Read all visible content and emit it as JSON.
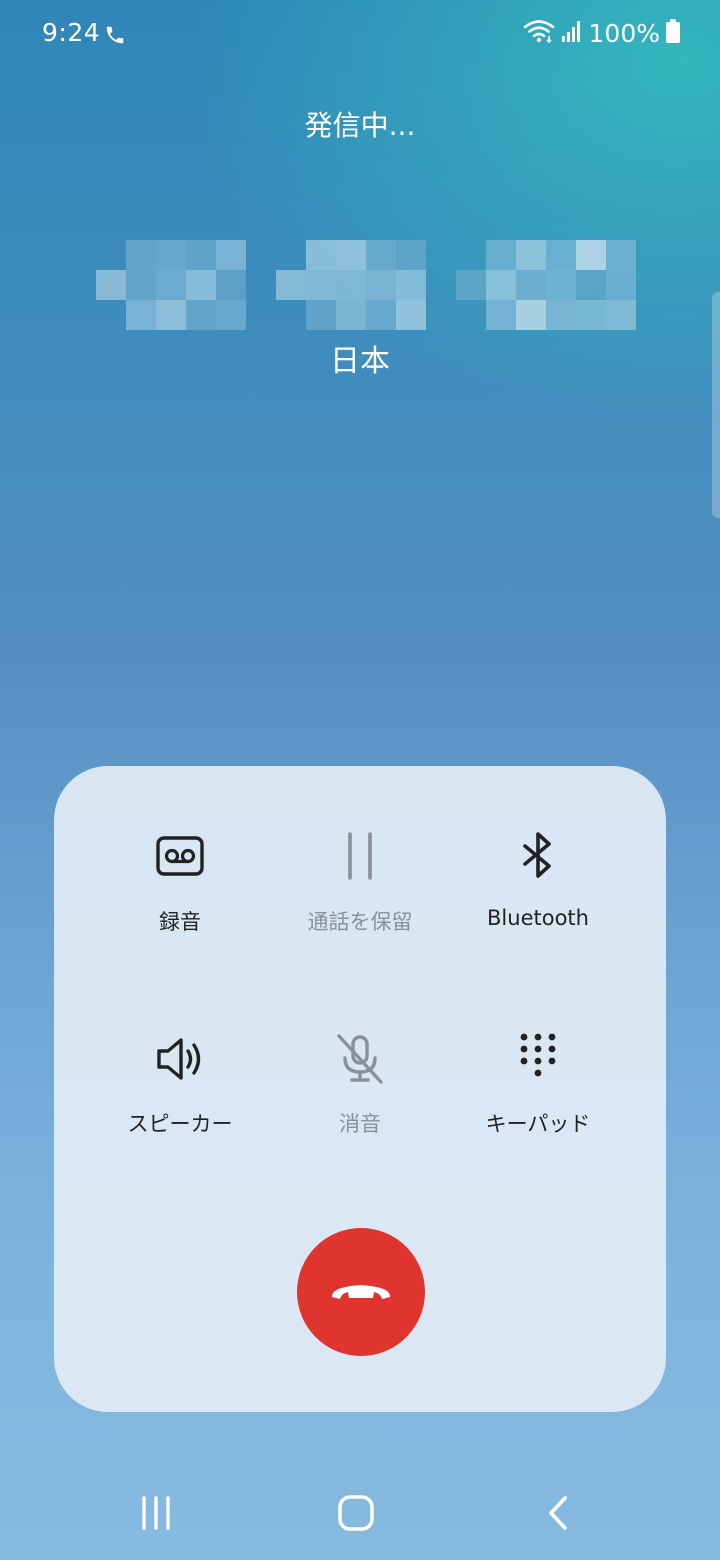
{
  "status_bar": {
    "time": "9:24",
    "battery": "100%",
    "icons": [
      "phone-call-icon",
      "wifi-icon",
      "signal-icon",
      "battery-icon"
    ]
  },
  "call": {
    "status": "発信中...",
    "country": "日本"
  },
  "controls": {
    "record": {
      "label": "録音",
      "icon": "voicemail-icon"
    },
    "hold": {
      "label": "通話を保留",
      "icon": "pause-icon"
    },
    "bluetooth": {
      "label": "Bluetooth",
      "icon": "bluetooth-icon"
    },
    "speaker": {
      "label": "スピーカー",
      "icon": "speaker-icon"
    },
    "mute": {
      "label": "消音",
      "icon": "mic-off-icon"
    },
    "keypad": {
      "label": "キーパッド",
      "icon": "dialpad-icon"
    }
  },
  "end_call": {
    "icon": "end-call-icon",
    "color": "#e0352e"
  },
  "nav": {
    "icons": [
      "recent-apps-icon",
      "home-icon",
      "back-icon"
    ]
  }
}
